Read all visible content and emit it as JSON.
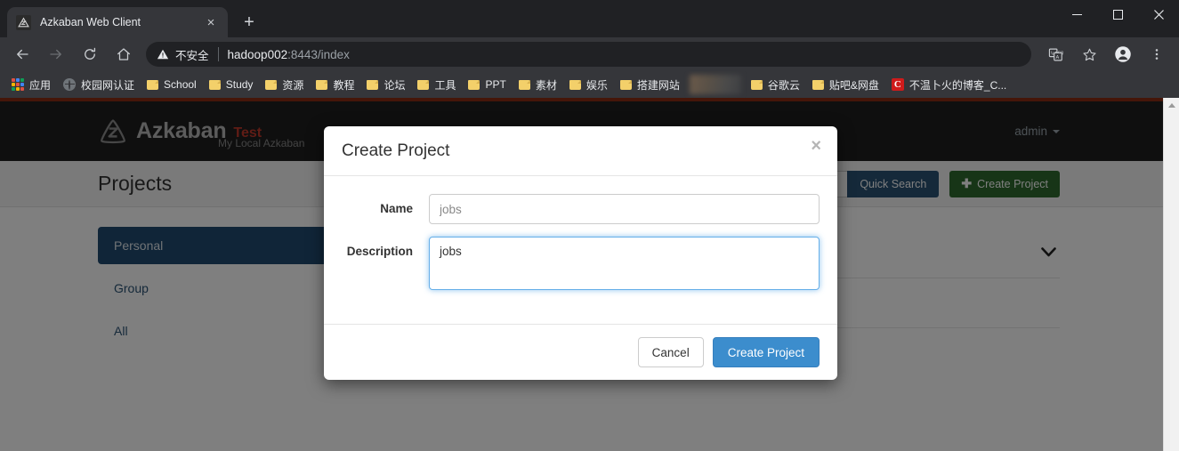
{
  "browser": {
    "tab": {
      "title": "Azkaban Web Client",
      "favicon_name": "azkaban-favicon",
      "close_label": "×"
    },
    "newtab_label": "+",
    "window_controls": {
      "minimize": "minimize",
      "maximize": "maximize",
      "close": "close"
    },
    "toolbar": {
      "back": "back",
      "forward": "forward",
      "reload": "reload",
      "home": "home",
      "translate": "translate",
      "bookmark_star": "bookmark",
      "profile": "profile",
      "menu": "menu"
    },
    "omnibox": {
      "security_label": "不安全",
      "url_host": "hadoop002",
      "url_rest": ":8443/index"
    },
    "bookmarks": [
      {
        "label": "应用",
        "icon": "apps-grid-icon"
      },
      {
        "label": "校园网认证",
        "icon": "globe-icon"
      },
      {
        "label": "School",
        "icon": "folder-icon"
      },
      {
        "label": "Study",
        "icon": "folder-icon"
      },
      {
        "label": "资源",
        "icon": "folder-icon"
      },
      {
        "label": "教程",
        "icon": "folder-icon"
      },
      {
        "label": "论坛",
        "icon": "folder-icon"
      },
      {
        "label": "工具",
        "icon": "folder-icon"
      },
      {
        "label": "PPT",
        "icon": "folder-icon"
      },
      {
        "label": "素材",
        "icon": "folder-icon"
      },
      {
        "label": "娱乐",
        "icon": "folder-icon"
      },
      {
        "label": "搭建网站",
        "icon": "folder-icon"
      },
      {
        "label": "",
        "icon": "blurred-bookmark"
      },
      {
        "label": "谷歌云",
        "icon": "folder-icon"
      },
      {
        "label": "贴吧&网盘",
        "icon": "folder-icon"
      },
      {
        "label": "不温卜火的博客_C...",
        "icon": "csdn-icon",
        "icon_text": "C"
      }
    ]
  },
  "app": {
    "brand": "Azkaban",
    "environment": "Test",
    "subtitle": "My Local Azkaban",
    "user": "admin",
    "page_title": "Projects",
    "search_placeholder": "",
    "quick_search_label": "Quick Search",
    "create_project_label": "Create Project",
    "create_project_plus": "✚",
    "sidebar": [
      {
        "label": "Personal",
        "active": true
      },
      {
        "label": "Group",
        "active": false
      },
      {
        "label": "All",
        "active": false
      }
    ],
    "expand_chevron": "❯"
  },
  "modal": {
    "title": "Create Project",
    "close_label": "×",
    "name_label": "Name",
    "name_value": "jobs",
    "name_placeholder": "jobs",
    "description_label": "Description",
    "description_value": "jobs",
    "cancel_label": "Cancel",
    "submit_label": "Create Project"
  },
  "colors": {
    "accent_red": "#8a2c12",
    "env_red": "#c0392b",
    "quick_search_blue": "#2b5374",
    "create_green": "#2f6b2f",
    "primary_blue": "#3c8dcd",
    "focus_blue": "#66afe9"
  }
}
